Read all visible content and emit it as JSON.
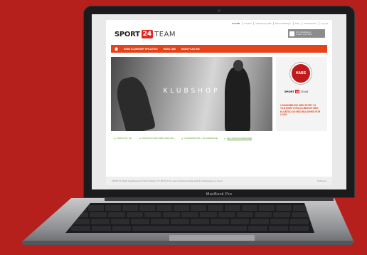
{
  "site": {
    "toplinks": [
      "Forside",
      "Kontakt",
      "Opkrævning.dkk",
      "Mine bestillinger",
      "FAQ",
      "Kundeservice",
      "Log ind"
    ],
    "logo": {
      "sport": "SPORT",
      "num": "24",
      "team": "TEAM"
    },
    "cart": {
      "line1": "Din indkøbskurv",
      "line2": "0 varer 0,00 DKK"
    },
    "nav": [
      "HABS KLUBSHOP SPILLETØJ",
      "HABS LØB",
      "HABS FLAG MIX"
    ],
    "hero_text": "KLUBSHOP",
    "badge": "HABS",
    "side_logo": {
      "sport": "SPORT",
      "num": "24",
      "team": "TEAM"
    },
    "side_text": "I SAMARBEJDE MED SPORT 24 TILBYDER VI EN KLUBSHOP MED KLUBTØJ OG MED MULIGHED FOR LOGO",
    "usps": [
      "FRAGT KR. 39,-",
      "FRAGTFRI VED KØB OVER 300,-",
      "LEVERINGSTID 7-10 HVERDAGE",
      "SE LOGOPLACERINGER"
    ],
    "footer": {
      "left": "SPORT 24 TEAM | Nygårdsvej 22 | 9310 Vodskov | Tlf. 98 25 19 11 | team.kundeservice@sport24.dk | Webshoppen er drevet",
      "right": "Webzones"
    }
  },
  "laptop": {
    "model": "MacBook Pro"
  },
  "colors": {
    "background": "#b5201c",
    "accent": "#e5431a",
    "brand_red": "#e3261f"
  }
}
